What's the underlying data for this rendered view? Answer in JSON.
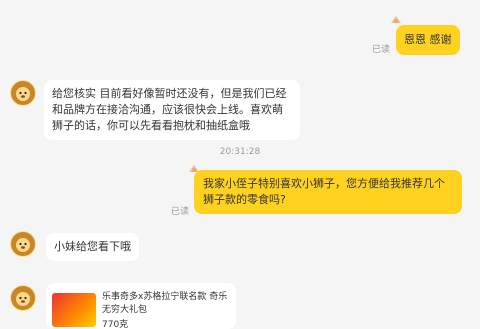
{
  "messages": {
    "m1": {
      "text": "恩恩 感谢",
      "status": "已读"
    },
    "m2": {
      "text": "给您核实 目前看好像暂时还没有，但是我们已经和品牌方在接洽沟通，应该很快会上线。喜欢萌狮子的话，你可以先看看抱枕和抽纸盒哦"
    },
    "timestamp": "20:31:28",
    "m3": {
      "text": "我家小侄子特别喜欢小狮子，您方便给我推荐几个狮子款的零食吗?",
      "status": "已读"
    },
    "m4": {
      "text": "小妹给您看下哦"
    },
    "product": {
      "title": "乐事奇多x苏格拉宁联名款 奇乐无穷大礼包",
      "price": "770克"
    }
  },
  "colors": {
    "background": "#f5f5f5",
    "outgoing_bubble": "#ffd21f",
    "incoming_bubble": "#ffffff",
    "read_text": "#9a9a9a"
  }
}
